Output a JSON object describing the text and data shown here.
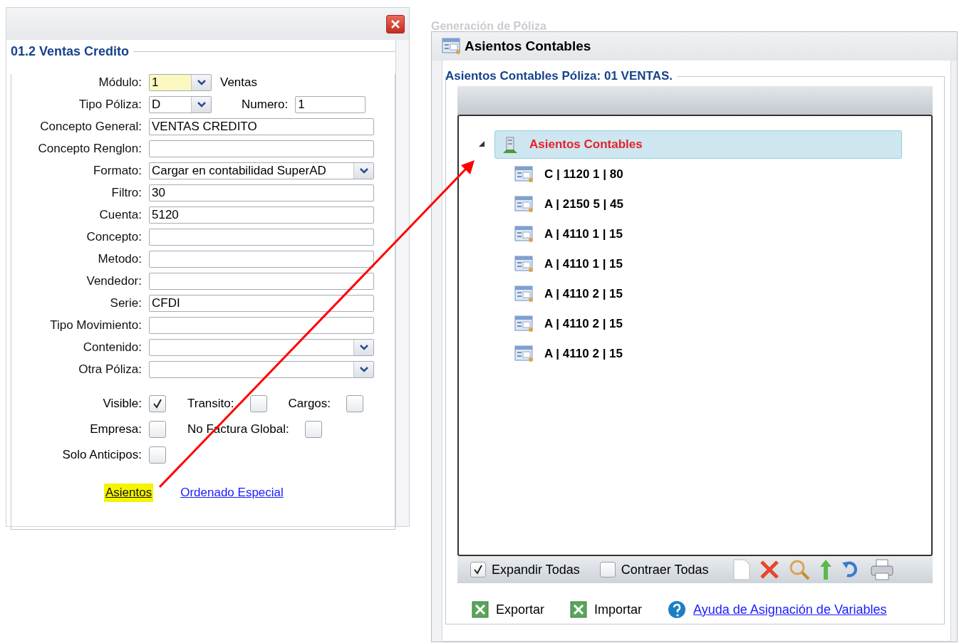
{
  "background_window": {
    "title": "Generación de Póliza"
  },
  "left_dialog": {
    "legend": "01.2 Ventas Credito",
    "fields": [
      {
        "label": "Módulo:",
        "kind": "small-select",
        "value": "1",
        "focused": true,
        "note": "Ventas"
      },
      {
        "label": "Tipo Póliza:",
        "kind": "small-select",
        "value": "D",
        "focused": false,
        "side_label": "Numero:",
        "side_value": "1"
      },
      {
        "label": "Concepto General:",
        "kind": "text",
        "value": "VENTAS CREDITO"
      },
      {
        "label": "Concepto Renglon:",
        "kind": "text"
      },
      {
        "label": "Formato:",
        "kind": "select",
        "value": "Cargar en contabilidad SuperAD"
      },
      {
        "label": "Filtro:",
        "kind": "text",
        "value": "30"
      },
      {
        "label": "Cuenta:",
        "kind": "text",
        "value": "5120"
      },
      {
        "label": "Concepto:",
        "kind": "text"
      },
      {
        "label": "Metodo:",
        "kind": "text"
      },
      {
        "label": "Vendedor:",
        "kind": "text"
      },
      {
        "label": "Serie:",
        "kind": "text",
        "value": "CFDI"
      },
      {
        "label": "Tipo Movimiento:",
        "kind": "text"
      },
      {
        "label": "Contenido:",
        "kind": "select"
      },
      {
        "label": "Otra Póliza:",
        "kind": "select"
      }
    ],
    "checkbox_rows": [
      [
        {
          "label": "Visible:",
          "checked": true
        },
        {
          "label": "Transito:",
          "checked": false
        },
        {
          "label": "Cargos:",
          "checked": false
        }
      ],
      [
        {
          "label": "Empresa:",
          "checked": false
        },
        {
          "label": "No Factura Global:",
          "checked": false
        }
      ],
      [
        {
          "label": "Solo Anticipos:",
          "checked": false
        }
      ]
    ],
    "links": [
      {
        "label": "Asientos",
        "highlighted": true
      },
      {
        "label": "Ordenado Especial",
        "highlighted": false
      }
    ]
  },
  "right_dialog": {
    "title": "Asientos Contables",
    "legend": "Asientos Contables Póliza: 01 VENTAS.",
    "tree": {
      "label": "Asientos Contables",
      "expanded": true,
      "selected": true,
      "children": [
        {
          "label": "C | 1120 1 | 80"
        },
        {
          "label": "A | 2150 5 | 45"
        },
        {
          "label": "A | 4110 1 | 15"
        },
        {
          "label": "A | 4110 1 | 15"
        },
        {
          "label": "A | 4110 2 | 15"
        },
        {
          "label": "A | 4110 2 | 15"
        },
        {
          "label": "A | 4110 2 | 15"
        }
      ]
    },
    "toolbar_checks": [
      {
        "label": "Expandir Todas",
        "checked": true
      },
      {
        "label": "Contraer Todas",
        "checked": false
      }
    ],
    "footer": [
      {
        "kind": "excel",
        "label": "Exportar"
      },
      {
        "kind": "excel",
        "label": "Importar"
      },
      {
        "kind": "help",
        "label": "Ayuda de Asignación de Variables"
      }
    ]
  }
}
